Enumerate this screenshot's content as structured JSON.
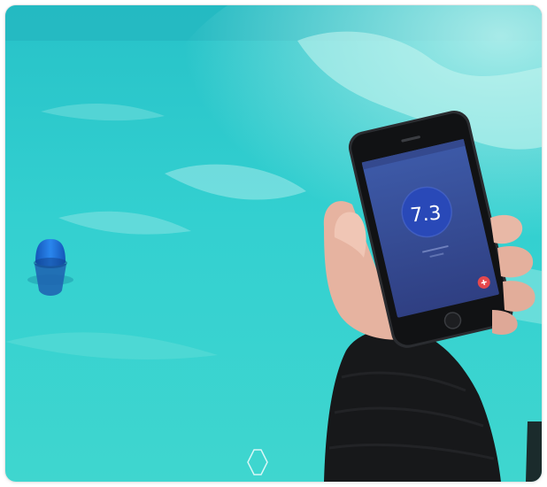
{
  "phone": {
    "reading": "7.3"
  },
  "colors": {
    "pool": "#2fcfcf",
    "sensor": "#1c6fd6",
    "screen": "#3a4f9a",
    "reading_circle": "#2949b8",
    "add_button": "#e5484d",
    "sleeve": "#17181a",
    "skin": "#e8b8a6"
  },
  "icons": {
    "nav_hexagon": "hexagon-outline-icon",
    "add": "plus-icon"
  }
}
